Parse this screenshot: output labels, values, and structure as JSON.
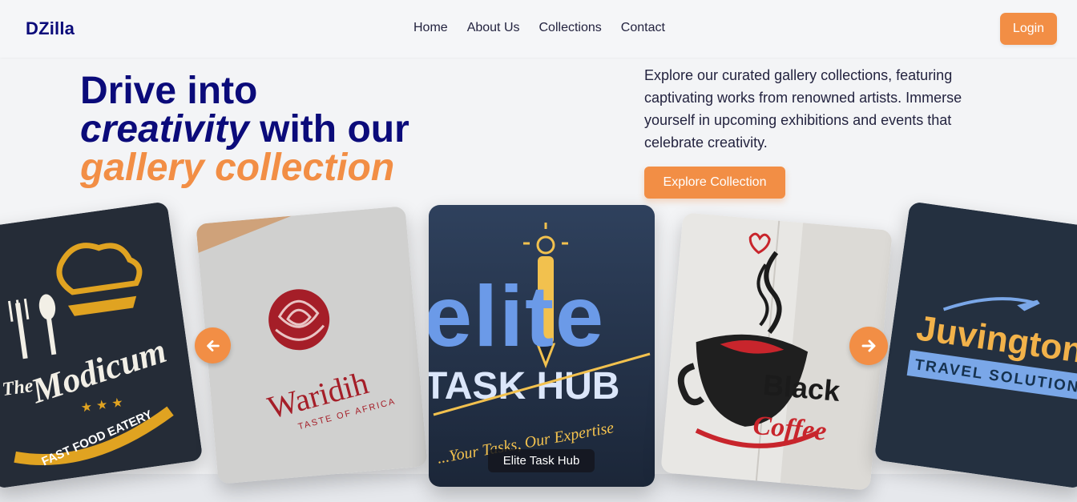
{
  "nav": {
    "brand": "DZilla",
    "links": [
      "Home",
      "About Us",
      "Collections",
      "Contact"
    ],
    "login_label": "Login"
  },
  "hero": {
    "line1": "Drive into",
    "line2_italic": "creativity",
    "line2_rest": " with our",
    "line3": "gallery collection",
    "blurb": "Explore our curated gallery collections, featuring captivating works from renowned artists. Immerse yourself in upcoming exhibitions and events that celebrate creativity.",
    "cta_label": "Explore Collection"
  },
  "carousel": {
    "active_caption": "Elite Task Hub",
    "cards": [
      {
        "title": "The Modicum",
        "lines": [
          "The",
          "Modicum",
          "FAST FOOD EATERY"
        ]
      },
      {
        "title": "Waridih",
        "lines": [
          "Waridih",
          "TASTE OF AFRICA"
        ]
      },
      {
        "title": "Elite Task Hub",
        "lines": [
          "elite",
          "TASK HUB",
          "...Your Tasks, Our Expertise"
        ]
      },
      {
        "title": "Black Coffee",
        "lines": [
          "Black",
          "Coffee"
        ]
      },
      {
        "title": "Juvington",
        "lines": [
          "Juvington",
          "TRAVEL SOLUTIONS"
        ]
      }
    ],
    "prev_icon": "arrow-left-icon",
    "next_icon": "arrow-right-icon"
  },
  "colors": {
    "brand_navy": "#0b0b7a",
    "accent_orange": "#f28e45",
    "background": "#f3f4f6"
  }
}
